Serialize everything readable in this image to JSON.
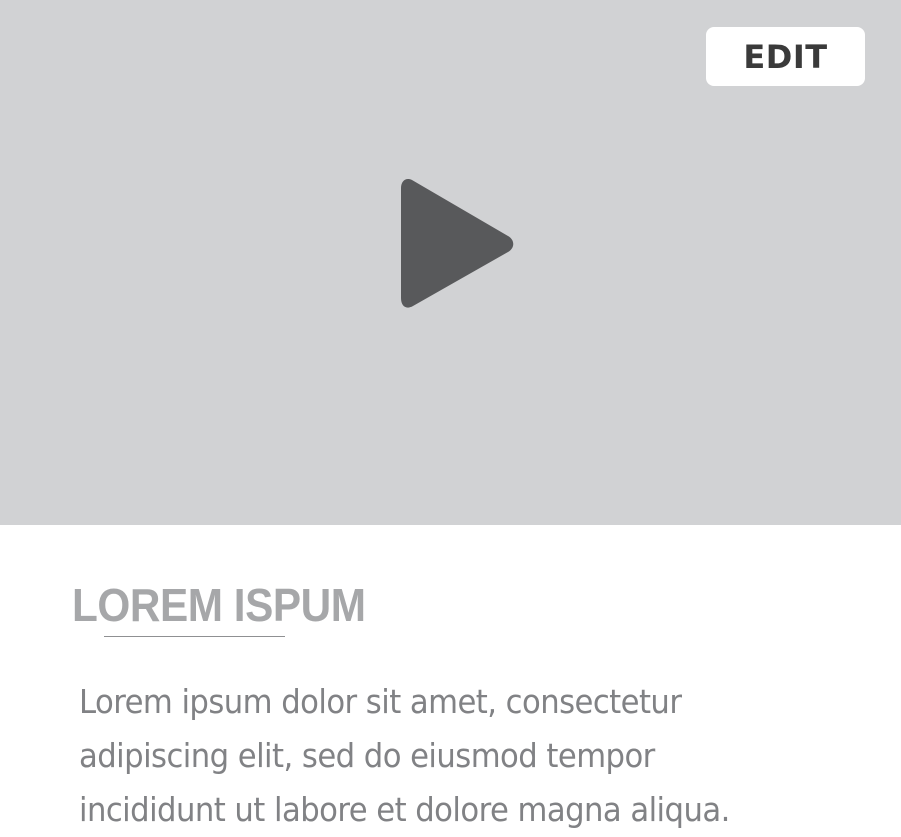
{
  "media": {
    "edit_label": "EDIT",
    "play_icon": "play-icon",
    "background_color": "#d1d2d4",
    "icon_color": "#58595b"
  },
  "content": {
    "title": "LOREM ISPUM",
    "body_lines": [
      "Lorem ipsum dolor sit amet, consectetur",
      "adipiscing elit, sed do eiusmod tempor",
      "incididunt ut labore et dolore magna aliqua."
    ]
  }
}
